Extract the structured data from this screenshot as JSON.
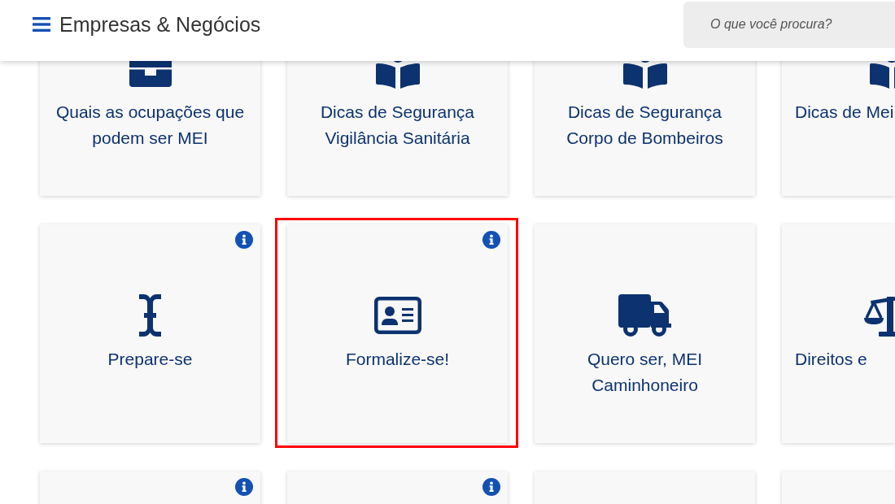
{
  "header": {
    "title": "Empresas & Negócios",
    "search": {
      "placeholder": "O que você procura?"
    }
  },
  "cards": [
    {
      "label": "Quais as ocupações que podem ser MEI",
      "info": false,
      "highlighted": false
    },
    {
      "label": "Dicas de Segurança Vigilância Sanitária",
      "info": false,
      "highlighted": false
    },
    {
      "label": "Dicas de Segurança Corpo de Bombeiros",
      "info": false,
      "highlighted": false
    },
    {
      "label": "Dicas de Mei",
      "info": false,
      "highlighted": false
    },
    {
      "label": "Prepare-se",
      "info": true,
      "highlighted": false
    },
    {
      "label": "Formalize-se!",
      "info": true,
      "highlighted": true
    },
    {
      "label": "Quero ser, MEI Caminhoneiro",
      "info": false,
      "highlighted": false
    },
    {
      "label": "Direitos e",
      "info": false,
      "highlighted": false
    },
    {
      "info": true,
      "highlighted": false
    },
    {
      "info": true,
      "highlighted": false
    },
    {
      "info": false,
      "highlighted": false
    },
    {
      "info": false,
      "highlighted": false
    }
  ]
}
